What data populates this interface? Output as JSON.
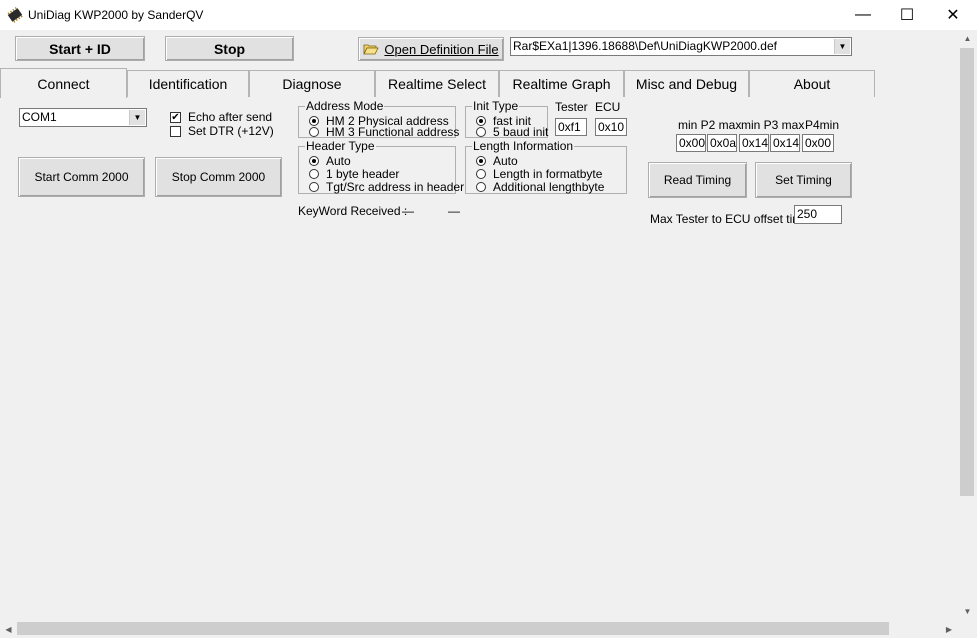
{
  "window": {
    "title": "UniDiag KWP2000 by SanderQV",
    "minimize": "—",
    "maximize": "☐",
    "close": "✕"
  },
  "toolbar": {
    "start_id": "Start + ID",
    "stop": "Stop",
    "open_def_label": "Open Definition File",
    "def_path": "Rar$EXa1|1396.18688\\Def\\UniDiagKWP2000.def"
  },
  "tabs": [
    "Connect",
    "Identification",
    "Diagnose",
    "Realtime Select",
    "Realtime Graph",
    "Misc and Debug",
    "About"
  ],
  "connect": {
    "com_port": "COM1",
    "echo_label": "Echo after send",
    "echo_checked": "✔",
    "dtr_label": "Set DTR (+12V)",
    "start_comm": "Start Comm 2000",
    "stop_comm": "Stop  Comm 2000",
    "address_mode": {
      "title": "Address Mode",
      "options": [
        "HM 2 Physical address",
        "HM 3 Functional address"
      ]
    },
    "init_type": {
      "title": "Init Type",
      "options": [
        "fast init",
        "5 baud init"
      ]
    },
    "tester_label": "Tester",
    "ecu_label": "ECU",
    "tester_value": "0xf1",
    "ecu_value": "0x10",
    "header_type": {
      "title": "Header Type",
      "options": [
        "Auto",
        "1 byte  header",
        "Tgt/Src address in header"
      ]
    },
    "length_info": {
      "title": "Length Information",
      "options": [
        "Auto",
        "Length in formatbyte",
        "Additional lengthbyte"
      ]
    },
    "keyword_label": "KeyWord Received :",
    "keyword_val1": "—",
    "keyword_val2": "—",
    "timing": {
      "label_p2": "min P2 max",
      "label_p3": "min P3 max",
      "label_p4": "P4min",
      "values": [
        "0x00",
        "0x0a",
        "0x14",
        "0x14",
        "0x00"
      ],
      "read_timing": "Read Timing",
      "set_timing": "Set Timing",
      "offset_label": "Max Tester to ECU offset time",
      "offset_value": "250"
    }
  }
}
